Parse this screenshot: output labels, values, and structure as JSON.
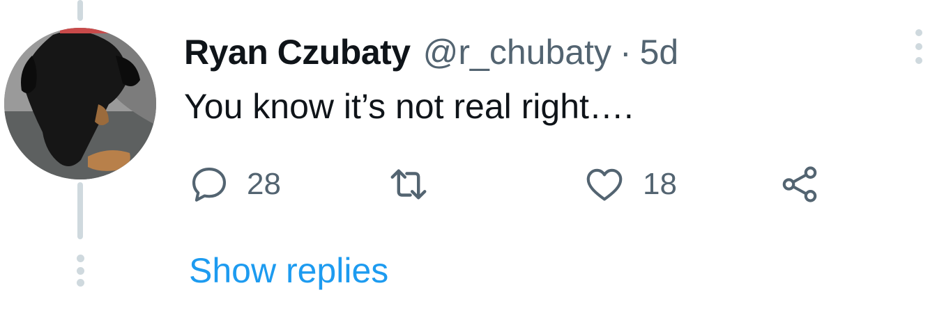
{
  "tweet": {
    "author_name": "Ryan Czubaty",
    "handle": "@r_chubaty",
    "separator": "·",
    "time": "5d",
    "text": "You know it’s not real right….",
    "reply_count": "28",
    "retweet_count": "",
    "like_count": "18"
  },
  "icons": {
    "reply": "reply-icon",
    "retweet": "retweet-icon",
    "like": "heart-icon",
    "share": "share-icon",
    "more": "more-vertical-icon"
  },
  "thread": {
    "show_replies_label": "Show replies"
  },
  "colors": {
    "text_primary": "#0f1419",
    "text_secondary": "#536471",
    "link": "#1d9bf0",
    "thread_line": "#cfd9de"
  }
}
